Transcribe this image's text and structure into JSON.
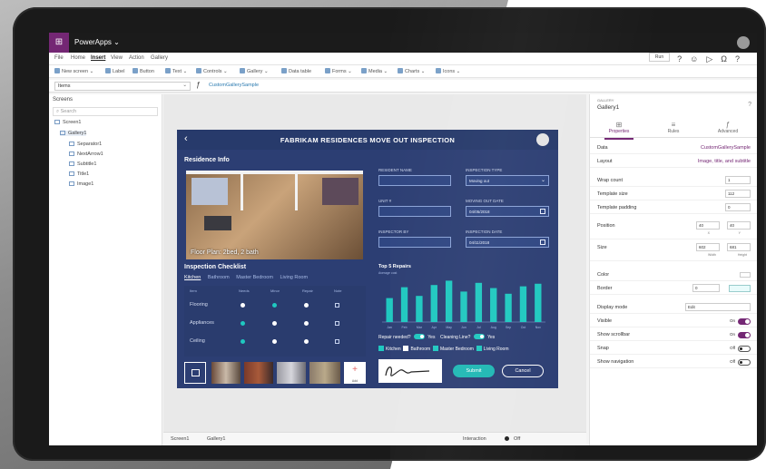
{
  "app": {
    "tile_glyph": "⊞",
    "name": "PowerApps",
    "chevron": "⌄"
  },
  "menu": {
    "items": [
      "File",
      "Home",
      "Insert",
      "View",
      "Action",
      "Gallery"
    ],
    "active_index": 2,
    "right_button": "Run",
    "right_icons": [
      "?",
      "☺",
      "▷",
      "Ω",
      "?"
    ]
  },
  "ribbon": {
    "items": [
      "New screen ⌄",
      "Label",
      "Button",
      "Text ⌄",
      "Controls ⌄",
      "Gallery ⌄",
      "Data table",
      "Forms ⌄",
      "Media ⌄",
      "Charts ⌄",
      "Icons ⌄"
    ]
  },
  "formula": {
    "property": "Items",
    "fx": "ƒ",
    "expression": "CustomGallerySample"
  },
  "tree": {
    "title": "Screens",
    "search_placeholder": "Search",
    "nodes": [
      {
        "label": "Screen1",
        "depth": 0,
        "selected": false
      },
      {
        "label": "Gallery1",
        "depth": 1,
        "selected": true
      },
      {
        "label": "Separator1",
        "depth": 2,
        "selected": false
      },
      {
        "label": "NextArrow1",
        "depth": 2,
        "selected": false
      },
      {
        "label": "Subtitle1",
        "depth": 2,
        "selected": false
      },
      {
        "label": "Title1",
        "depth": 2,
        "selected": false
      },
      {
        "label": "Image1",
        "depth": 2,
        "selected": false
      }
    ]
  },
  "status": {
    "screen": "Screen1",
    "control": "Gallery1",
    "interaction_label": "Interaction",
    "interaction_state": "Off"
  },
  "appcard": {
    "back": "‹",
    "title": "FABRIKAM RESIDENCES MOVE OUT INSPECTION",
    "residence_title": "Residence Info",
    "floorplan_caption": "Floor Plan: 2bed, 2 bath",
    "fields": [
      {
        "label": "Resident Name",
        "value": ""
      },
      {
        "label": "Inspection Type",
        "value": "Moving out",
        "kind": "dropdown"
      },
      {
        "label": "Unit #",
        "value": ""
      },
      {
        "label": "Moving Out Date",
        "value": "04/05/2018",
        "kind": "date"
      },
      {
        "label": "Inspector By",
        "value": ""
      },
      {
        "label": "Inspection Date",
        "value": "04/11/2018",
        "kind": "date"
      }
    ],
    "checklist_title": "Inspection Checklist",
    "tabs": [
      "Kitchen",
      "Bathroom",
      "Master Bedroom",
      "Living Room"
    ],
    "checklist_headers": [
      "Item",
      "Needs",
      "Minor",
      "Repair",
      "Note"
    ],
    "checklist_rows": [
      "Flooring",
      "Appliances",
      "Ceiling"
    ],
    "add_label": "Add",
    "chart_title": "Top 5 Repairs",
    "chart_subtitle": "Average cost",
    "repair_needed": "Repair needed?",
    "repair_value": "Yes",
    "cleaning_line": "Cleaning Line?",
    "cleaning_value": "Yes",
    "check_items": [
      "Kitchen",
      "Bathroom",
      "Master Bedroom",
      "Living Room"
    ],
    "submit": "Submit",
    "cancel": "Cancel"
  },
  "chart_data": {
    "type": "bar",
    "title": "Top 5 Repairs",
    "categories": [
      "Jan",
      "Feb",
      "Mar",
      "Apr",
      "May",
      "Jun",
      "Jul",
      "Aug",
      "Sep",
      "Oct",
      "Nov"
    ],
    "values": [
      55,
      80,
      60,
      85,
      95,
      70,
      90,
      78,
      65,
      82,
      88
    ],
    "ylim": [
      0,
      100
    ],
    "color": "#1fc8c0"
  },
  "props": {
    "type": "GALLERY",
    "name": "Gallery1",
    "tabs": [
      {
        "icon": "⊞",
        "label": "Properties"
      },
      {
        "icon": "≡",
        "label": "Rules"
      },
      {
        "icon": "ƒ",
        "label": "Advanced"
      }
    ],
    "rows": {
      "data": {
        "label": "Data",
        "value": "CustomGallerySample"
      },
      "layout": {
        "label": "Layout",
        "value": "Image, title, and subtitle"
      },
      "wrap": {
        "label": "Wrap count",
        "value": "1"
      },
      "tsize": {
        "label": "Template size",
        "value": "112"
      },
      "tpad": {
        "label": "Template padding",
        "value": "0"
      },
      "position": {
        "label": "Position",
        "x": "40",
        "y": "40",
        "x_cap": "X",
        "y_cap": "Y"
      },
      "size": {
        "label": "Size",
        "w": "602",
        "h": "681",
        "w_cap": "Width",
        "h_cap": "Height"
      },
      "color": {
        "label": "Color"
      },
      "border": {
        "label": "Border",
        "value": "0"
      },
      "display": {
        "label": "Display mode",
        "value": "Edit"
      },
      "visible": {
        "label": "Visible",
        "state": "On"
      },
      "scrollbar": {
        "label": "Show scrollbar",
        "state": "On"
      },
      "snap": {
        "label": "Snap",
        "state": "Off"
      },
      "navigation": {
        "label": "Show navigation",
        "state": "Off"
      }
    }
  },
  "colors": {
    "accent": "#742774",
    "app_bg": "#2c3e73",
    "teal": "#1fc8c0"
  }
}
